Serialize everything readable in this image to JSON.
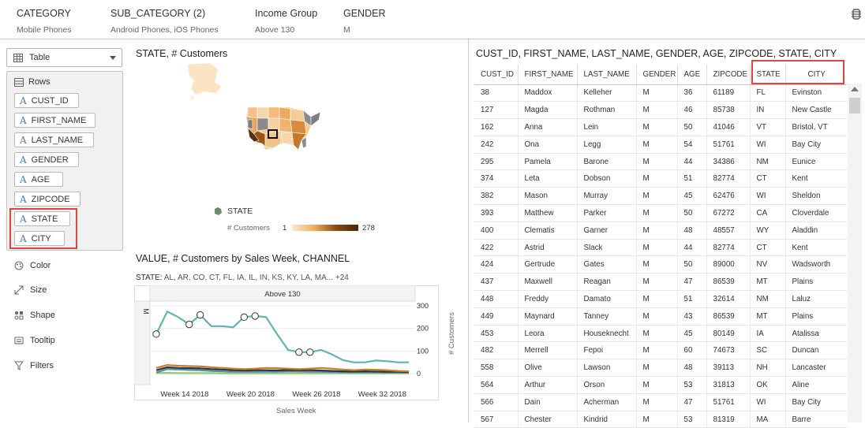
{
  "filters": [
    {
      "label": "CATEGORY",
      "value": "Mobile Phones"
    },
    {
      "label": "SUB_CATEGORY (2)",
      "value": "Android Phones, iOS Phones"
    },
    {
      "label": "Income Group",
      "value": "Above 130"
    },
    {
      "label": "GENDER",
      "value": "M"
    }
  ],
  "left_panel": {
    "viz_type": "Table",
    "rows_label": "Rows",
    "rows": [
      "CUST_ID",
      "FIRST_NAME",
      "LAST_NAME",
      "GENDER",
      "AGE",
      "ZIPCODE",
      "STATE",
      "CITY"
    ],
    "properties": [
      "Color",
      "Size",
      "Shape",
      "Tooltip",
      "Filters"
    ]
  },
  "map": {
    "title": "STATE, # Customers",
    "legend_shape_label": "STATE",
    "legend_measure_label": "# Customers",
    "legend_min": "1",
    "legend_max": "278"
  },
  "chart": {
    "title": "VALUE, # Customers by Sales Week, CHANNEL",
    "filter_label": "STATE:",
    "filter_value": "AL, AR, CO, CT, FL, IA, IL, IN, KS, KY, LA, MA... +24",
    "panel_header": "Above 130",
    "row_label": "M",
    "y_axis_title": "# Customers",
    "x_axis_title": "Sales Week",
    "y_ticks": [
      "300",
      "200",
      "100",
      "0"
    ],
    "x_ticks": [
      "Week 14 2018",
      "Week 20 2018",
      "Week 26 2018",
      "Week 32 2018"
    ]
  },
  "chart_data": {
    "type": "line",
    "x": [
      "Week 14 2018",
      "Week 20 2018",
      "Week 26 2018",
      "Week 32 2018"
    ],
    "ylim": [
      0,
      300
    ],
    "series": [
      {
        "color": "#5bb7b0",
        "values": [
          175,
          275,
          250,
          218,
          260,
          210,
          210,
          205,
          250,
          255,
          250,
          175,
          105,
          95,
          95,
          105,
          85,
          60,
          50,
          50,
          58,
          55,
          50,
          50
        ]
      },
      {
        "color": "#d07a28",
        "values": [
          25,
          38,
          35,
          33,
          32,
          28,
          25,
          22,
          20,
          22,
          25,
          24,
          22,
          20,
          22,
          25,
          22,
          18,
          15,
          18,
          17,
          15,
          12,
          10
        ]
      },
      {
        "color": "#1f3a4a",
        "values": [
          15,
          28,
          25,
          24,
          23,
          20,
          18,
          15,
          14,
          15,
          15,
          14,
          16,
          15,
          15,
          14,
          12,
          10,
          9,
          10,
          9,
          8,
          8,
          7
        ]
      },
      {
        "color": "#5a8f96",
        "values": [
          5,
          20,
          18,
          16,
          15,
          12,
          10,
          8,
          8,
          8,
          9,
          8,
          10,
          9,
          8,
          8,
          7,
          6,
          6,
          6,
          6,
          5,
          5,
          5
        ]
      },
      {
        "color": "#8fc77a",
        "values": [
          2,
          3,
          2,
          2,
          2,
          2,
          1,
          1,
          1,
          1,
          1,
          1,
          1,
          1,
          1,
          1,
          1,
          1,
          1,
          1,
          1,
          1,
          1,
          1
        ]
      }
    ]
  },
  "table": {
    "title": "CUST_ID, FIRST_NAME, LAST_NAME, GENDER, AGE, ZIPCODE, STATE, CITY",
    "columns": [
      "CUST_ID",
      "FIRST_NAME",
      "LAST_NAME",
      "GENDER",
      "AGE",
      "ZIPCODE",
      "STATE",
      "CITY"
    ],
    "rows": [
      [
        "38",
        "Maddox",
        "Kelleher",
        "M",
        "36",
        "61189",
        "FL",
        "Evinston"
      ],
      [
        "127",
        "Magda",
        "Rothman",
        "M",
        "46",
        "85738",
        "IN",
        "New Castle"
      ],
      [
        "162",
        "Anna",
        "Lein",
        "M",
        "50",
        "41046",
        "VT",
        "Bristol, VT"
      ],
      [
        "242",
        "Ona",
        "Legg",
        "M",
        "54",
        "51761",
        "WI",
        "Bay City"
      ],
      [
        "295",
        "Pamela",
        "Barone",
        "M",
        "44",
        "34386",
        "NM",
        "Eunice"
      ],
      [
        "374",
        "Leta",
        "Dobson",
        "M",
        "51",
        "82774",
        "CT",
        "Kent"
      ],
      [
        "382",
        "Mason",
        "Murray",
        "M",
        "45",
        "62476",
        "WI",
        "Sheldon"
      ],
      [
        "393",
        "Matthew",
        "Parker",
        "M",
        "50",
        "67272",
        "CA",
        "Cloverdale"
      ],
      [
        "400",
        "Clematis",
        "Garner",
        "M",
        "48",
        "48557",
        "WY",
        "Aladdin"
      ],
      [
        "422",
        "Astrid",
        "Slack",
        "M",
        "44",
        "82774",
        "CT",
        "Kent"
      ],
      [
        "424",
        "Gertrude",
        "Gates",
        "M",
        "50",
        "89000",
        "NV",
        "Wadsworth"
      ],
      [
        "437",
        "Maxwell",
        "Reagan",
        "M",
        "47",
        "86539",
        "MT",
        "Plains"
      ],
      [
        "448",
        "Freddy",
        "Damato",
        "M",
        "51",
        "32614",
        "NM",
        "Laluz"
      ],
      [
        "449",
        "Maynard",
        "Tanney",
        "M",
        "43",
        "86539",
        "MT",
        "Plains"
      ],
      [
        "453",
        "Leora",
        "Houseknecht",
        "M",
        "45",
        "80149",
        "IA",
        "Atalissa"
      ],
      [
        "482",
        "Merrell",
        "Fepoi",
        "M",
        "60",
        "74673",
        "SC",
        "Duncan"
      ],
      [
        "558",
        "Olive",
        "Lawson",
        "M",
        "48",
        "39113",
        "NH",
        "Lancaster"
      ],
      [
        "564",
        "Arthur",
        "Orson",
        "M",
        "53",
        "31813",
        "OK",
        "Aline"
      ],
      [
        "566",
        "Dain",
        "Acherman",
        "M",
        "47",
        "51761",
        "WI",
        "Bay City"
      ],
      [
        "567",
        "Chester",
        "Kindrid",
        "M",
        "53",
        "81319",
        "MA",
        "Barre"
      ]
    ]
  }
}
